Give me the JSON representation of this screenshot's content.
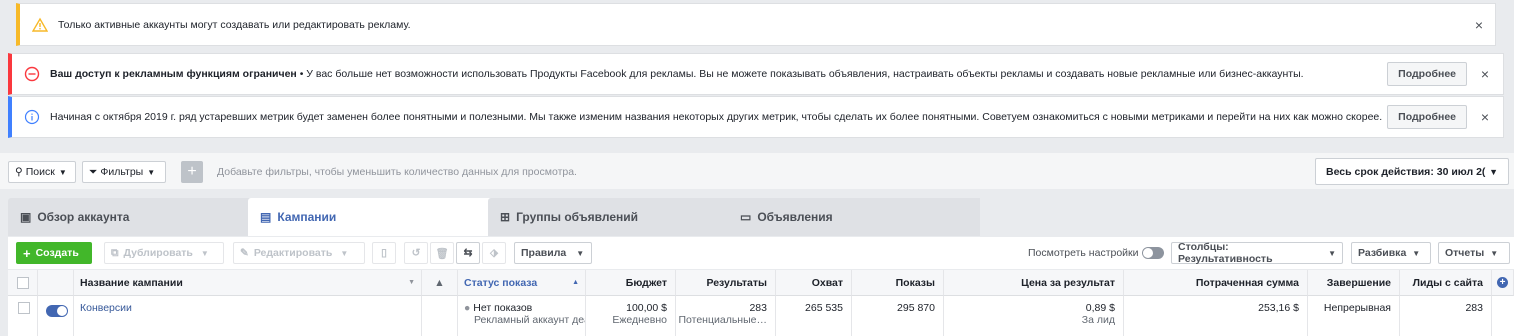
{
  "banners": {
    "warning_text": "Только активные аккаунты могут создавать или редактировать рекламу.",
    "error_bold": "Ваш доступ к рекламным функциям ограничен",
    "error_text": " • У вас больше нет возможности использовать Продукты Facebook для рекламы. Вы не можете показывать объявления, настраивать объекты рекламы и создавать новые рекламные или бизнес-аккаунты.",
    "info_text": "Начиная с октября 2019 г. ряд устаревших метрик будет заменен более понятными и полезными. Мы также изменим названия некоторых других метрик, чтобы сделать их более понятными. Советуем ознакомиться с новыми метриками и перейти на них как можно скорее.",
    "more_label": "Подробнее",
    "close_glyph": "×"
  },
  "filterbar": {
    "search_label": "Поиск",
    "filters_label": "Фильтры",
    "plus_glyph": "+",
    "placeholder": "Добавьте фильтры, чтобы уменьшить количество данных для просмотра.",
    "date_label": "Весь срок действия: 30 июл 2("
  },
  "tabs": {
    "account": "Обзор аккаунта",
    "campaigns": "Кампании",
    "adsets": "Группы объявлений",
    "ads": "Объявления"
  },
  "toolbar": {
    "create": "Создать",
    "duplicate": "Дублировать",
    "edit": "Редактировать",
    "rules": "Правила",
    "view_settings": "Посмотреть настройки",
    "columns": "Столбцы: Результативность",
    "breakdown": "Разбивка",
    "reports": "Отчеты"
  },
  "table": {
    "headers": {
      "name": "Название кампании",
      "status": "Статус показа",
      "budget": "Бюджет",
      "results": "Результаты",
      "reach": "Охват",
      "impressions": "Показы",
      "cost": "Цена за результат",
      "spent": "Потраченная сумма",
      "end": "Завершение",
      "leads": "Лиды с сайта"
    },
    "row": {
      "name": "Конверсии",
      "status": "Нет показов",
      "status_sub": "Рекламный аккаунт деак",
      "budget": "100,00 $",
      "budget_sub": "Ежедневно",
      "results": "283",
      "results_sub": "Потенциальные…",
      "reach": "265 535",
      "impressions": "295 870",
      "cost": "0,89 $",
      "cost_sub": "За лид",
      "spent": "253,16 $",
      "end": "Непрерывная",
      "leads": "283"
    }
  },
  "colors": {
    "accent": "#4267b2",
    "create": "#42b72a",
    "warning": "#f7b928",
    "error": "#fa383e",
    "info": "#4080ff"
  }
}
